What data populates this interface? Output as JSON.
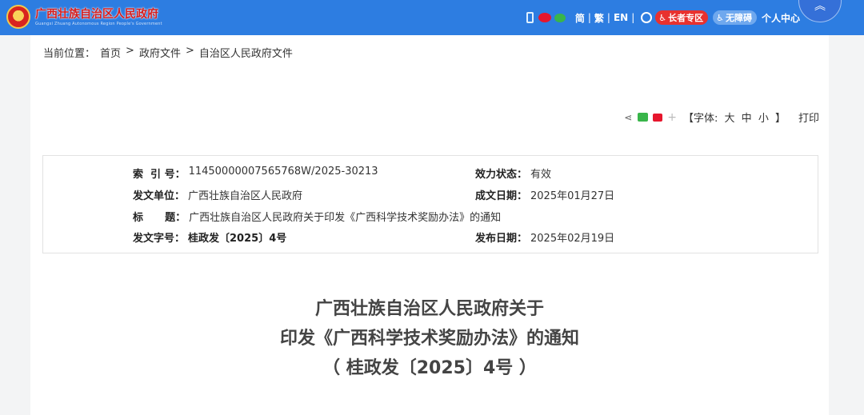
{
  "header": {
    "site_name": "广西壮族自治区人民政府",
    "site_name_en": "Guangxi Zhuang Autonomous Region People's Government",
    "lang_simplified": "简",
    "lang_traditional": "繁",
    "lang_english": "EN",
    "separator": "|",
    "elder_zone": "长者专区",
    "accessibility": "无障碍",
    "user_center": "个人中心",
    "icons": [
      "phone-icon",
      "weibo-icon",
      "wechat-icon",
      "globe-icon",
      "elder-icon",
      "wheelchair-icon",
      "chevron-up-icon"
    ],
    "colors": {
      "bar": "#2d7de1",
      "elder": "#e8312f",
      "accent": "#3570d8"
    }
  },
  "breadcrumb": {
    "prefix": "当前位置：",
    "items": [
      "首页",
      "政府文件",
      "自治区人民政府文件"
    ],
    "divider": ">"
  },
  "tools": {
    "font_prefix": "【字体:",
    "font_large": "大",
    "font_medium": "中",
    "font_small": "小",
    "font_suffix": "】",
    "print": "打印",
    "plus": "+"
  },
  "info": {
    "index_label": "索  引 号：",
    "index_value": "11450000007565768W/2025-30213",
    "status_label": "效力状态：",
    "status_value": "有效",
    "issuer_label": "发文单位：",
    "issuer_value": "广西壮族自治区人民政府",
    "created_label": "成文日期：",
    "created_value": "2025年01月27日",
    "title_label": "标      题：",
    "title_value": "广西壮族自治区人民政府关于印发《广西科学技术奖励办法》的通知",
    "docno_label": "发文字号：",
    "docno_value": "桂政发〔2025〕4号",
    "published_label": "发布日期：",
    "published_value": "2025年02月19日"
  },
  "document": {
    "title_line1": "广西壮族自治区人民政府关于",
    "title_line2": "印发《广西科学技术奖励办法》的通知",
    "title_line3": "（ 桂政发〔2025〕4号 ）"
  }
}
